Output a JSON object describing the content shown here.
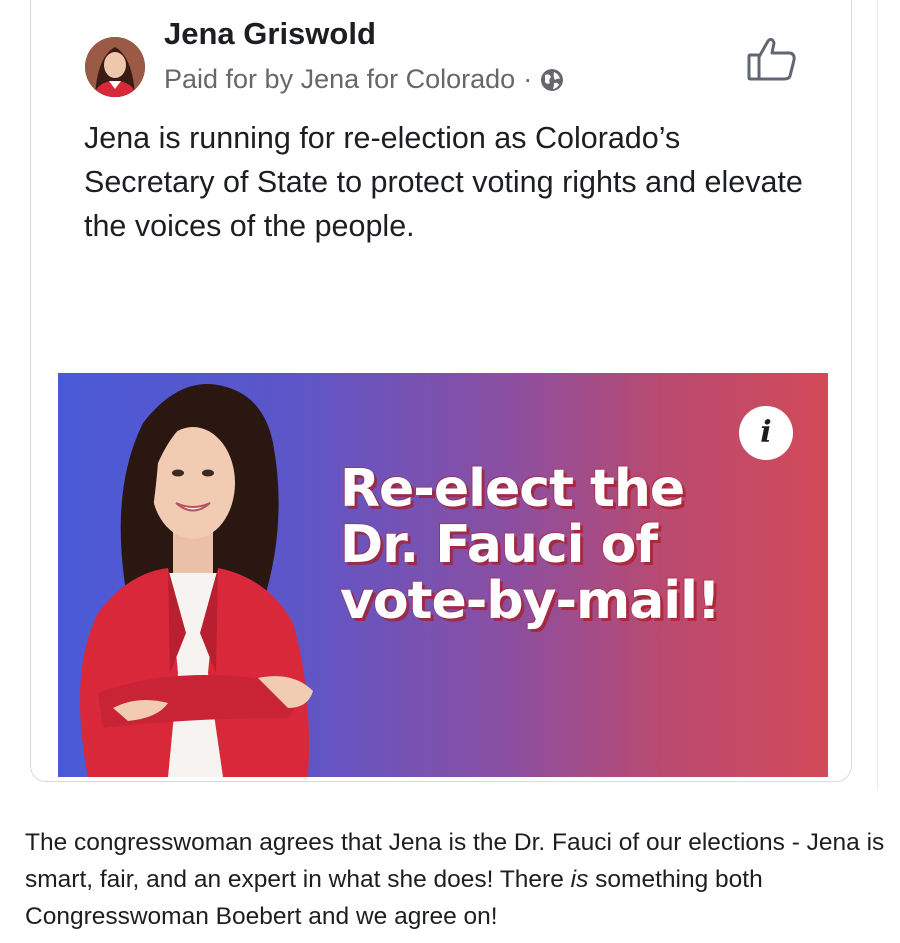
{
  "post": {
    "author_name": "Jena Griswold",
    "sponsor_text": "Paid for by Jena for Colorado",
    "separator": "·",
    "body": "Jena is running for re-election as Colorado’s Secretary of State to protect voting rights and elevate the voices of the people.",
    "icons": {
      "like": "thumbs-up-icon",
      "audience": "globe-icon",
      "info": "info-icon"
    }
  },
  "banner": {
    "headline_line1": "Re-elect the",
    "headline_line2": "Dr. Fauci of",
    "headline_line3": "vote-by-mail!",
    "info_glyph": "i",
    "colors": {
      "gradient_left": "#4a5ad6",
      "gradient_right": "#d24a58",
      "jacket": "#d9283a"
    }
  },
  "caption": {
    "part1": "The congresswoman agrees that Jena is the Dr. Fauci of our elections - Jena is smart, fair, and an expert in what she does! There ",
    "emphasis": "is",
    "part2": " something both Congresswoman Boebert and we agree on!"
  }
}
